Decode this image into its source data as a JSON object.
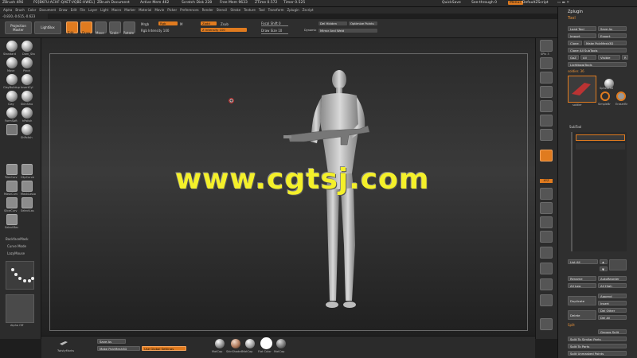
{
  "titlebar": {
    "app": "ZBrush 4R6",
    "build": "P2[BKFU-ACHF-QAET-VQBE-HWEL]",
    "document": "ZBrush Document",
    "active_mem": "Active Mem 462",
    "scratch": "Scratch Disk 228",
    "free_mem": "Free Mem 9633",
    "ztime": "ZTime 0.572",
    "timer": "Timer 0.525",
    "quicksave": "QuickSave",
    "see_through": "See-through 0",
    "menus": "Menus",
    "default_script": "DefaultZScript"
  },
  "menubar": [
    "Alpha",
    "Brush",
    "Color",
    "Document",
    "Draw",
    "Edit",
    "File",
    "Layer",
    "Light",
    "Macro",
    "Marker",
    "Material",
    "Movie",
    "Picker",
    "Preferences",
    "Render",
    "Stencil",
    "Stroke",
    "Texture",
    "Tool",
    "Transform",
    "Zplugin",
    "Zscript"
  ],
  "coords": "-0.830,-0.615,-0.623",
  "topshelf": {
    "projection_master": "Projection Master",
    "lightbox": "LightBox",
    "tools": [
      "Edit",
      "Draw",
      "Move",
      "Scale",
      "Rotate"
    ],
    "mrgb": "Mrgb",
    "rgb": "Rgb",
    "m": "M",
    "rgb_intensity": "Rgb Intensity 100",
    "zadd": "Zadd",
    "zsub": "Zsub",
    "z_intensity": "Z Intensity 100",
    "focal_shift": "Focal Shift 0",
    "draw_size": "Draw Size 10",
    "dynamic": "Dynamic",
    "del_hidden": "Del Hidden",
    "optimize_points": "Optimize Points",
    "mirror_and_weld": "Mirror And Weld"
  },
  "leftshelf": {
    "brushes": [
      "Standard",
      "Dam_Sta",
      "Move",
      "Pinch",
      "ClayBuildup",
      "InsertCyl",
      "Clay",
      "SkinSmo",
      "FormSoft",
      "hPolish",
      "",
      "ShPolish"
    ],
    "lower": [
      "TrimCurv",
      "ClipCurve",
      "MaskCurv",
      "MaskLasso",
      "SliceCurv",
      "SelectLas",
      "SelectRec"
    ],
    "backface_mask": "BackfaceMask",
    "curve_mode": "Curve Mode",
    "lazy_mouse": "LazyMouse",
    "alpha_off": "Alpha Off"
  },
  "rightshelf": [
    "SPix 3",
    "Scroll",
    "Zoom",
    "Actual",
    "AAHalf",
    "Persp",
    "Floor",
    "Local",
    "XYZ",
    "Frame",
    "Move",
    "Scale",
    "Rotate",
    "Line Fill",
    "Transp",
    "Ghost",
    "Solo",
    "Xpose"
  ],
  "toolpanel": {
    "zplugin": "Zplugin",
    "tool": "Tool",
    "load_tool": "Load Tool",
    "save_as": "Save As",
    "import": "Import",
    "export": "Export",
    "clone": "Clone",
    "make_polymesh": "Make PolyMesh3D",
    "clone_all_subtools": "Clone All SubTools",
    "goz": "GoZ",
    "all": "All",
    "visible": "Visible",
    "r": "R",
    "lightbox_tools": "Lightbox▸Tools",
    "current_tool": "soldier. 36",
    "thumb_labels": [
      "soldier",
      "Sphere3D",
      "SimpleBr",
      "EraserBr"
    ],
    "subtool": "SubTool",
    "list_all": "List All",
    "rename": "Rename",
    "auto_reorder": "AutoReorder",
    "all_low": "All Low",
    "all_high": "All High",
    "duplicate": "Duplicate",
    "append": "Append",
    "insert": "Insert",
    "delete": "Delete",
    "del_other": "Del Other",
    "del_all": "Del All",
    "split": "Split",
    "groups_split": "Groups Split",
    "split_similar": "Split To Similar Parts",
    "split_parts": "Split To Parts",
    "split_unmasked": "Split Unmasked Points"
  },
  "bottomshelf": {
    "tool_label": "TwistyMarks",
    "save_as": "Save As",
    "make_polymesh": "Make PolyMesh3D",
    "use_global": "Use Global Settings",
    "materials": [
      "MatCap",
      "SkinShade4",
      "MatCap",
      "Flat Color",
      "MatCap"
    ]
  },
  "watermark": "www.cgtsj.com",
  "colors": {
    "accent": "#e07b1f",
    "watermark": "#f4f02a"
  }
}
